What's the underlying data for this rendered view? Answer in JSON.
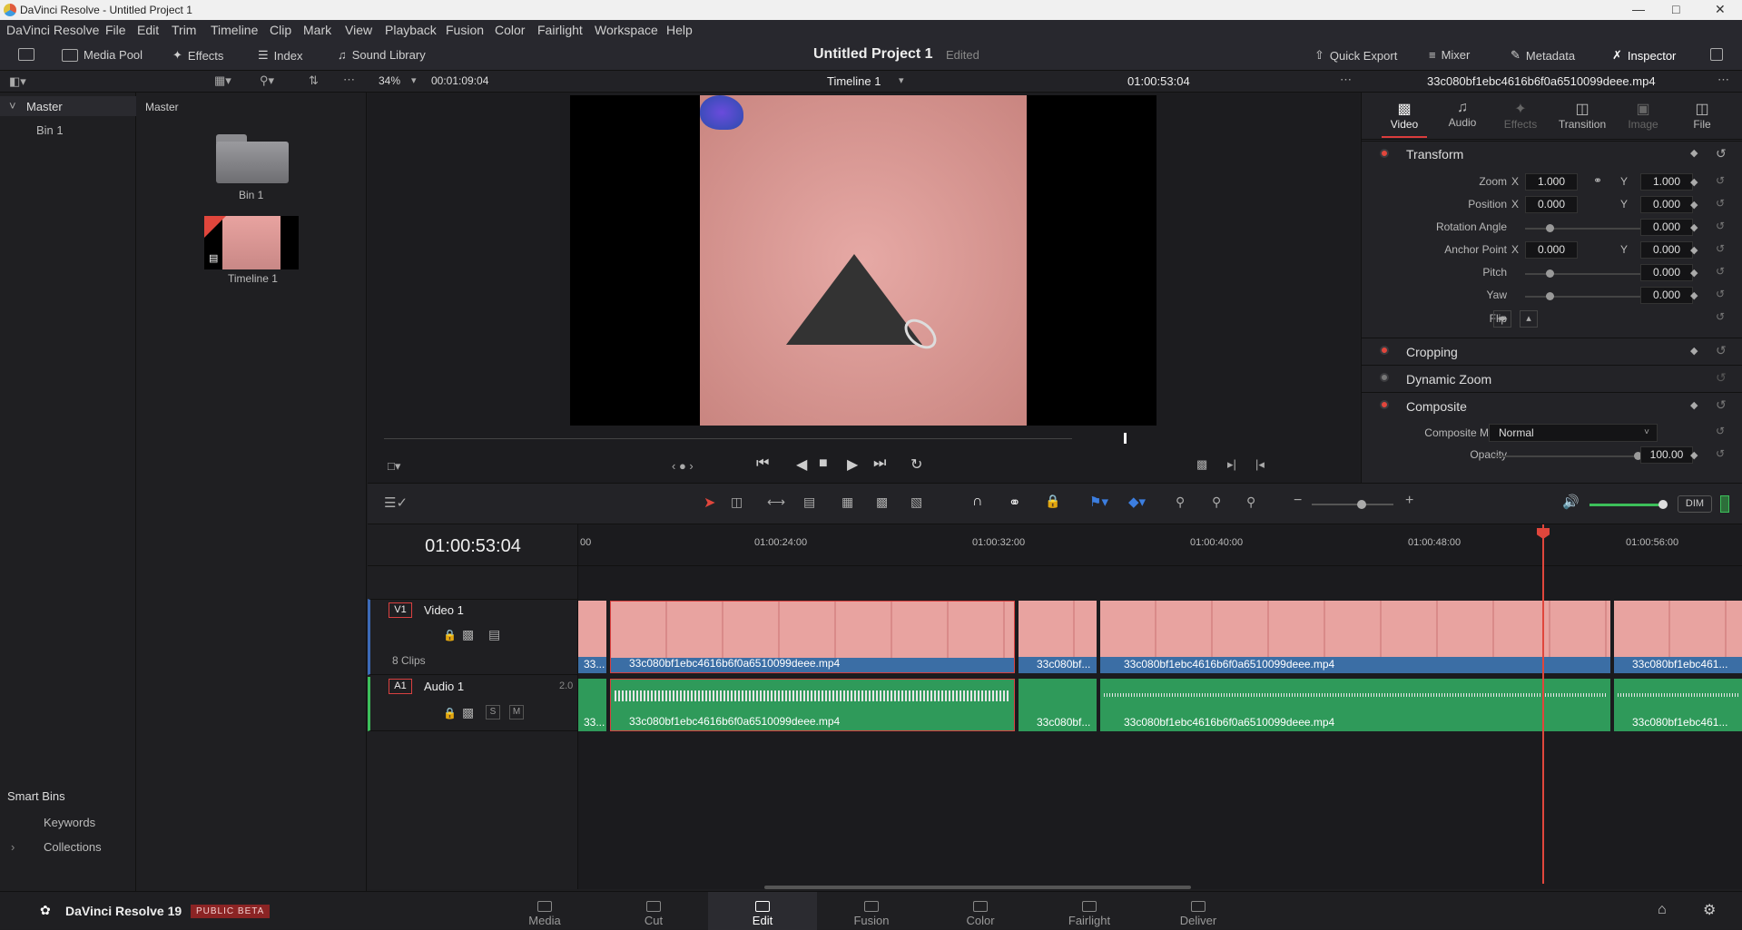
{
  "window": {
    "title": "DaVinci Resolve - Untitled Project 1"
  },
  "menu": [
    "DaVinci Resolve",
    "File",
    "Edit",
    "Trim",
    "Timeline",
    "Clip",
    "Mark",
    "View",
    "Playback",
    "Fusion",
    "Color",
    "Fairlight",
    "Workspace",
    "Help"
  ],
  "toolbar": {
    "media_pool": "Media Pool",
    "effects": "Effects",
    "index": "Index",
    "sound_library": "Sound Library",
    "project_title": "Untitled Project 1",
    "project_status": "Edited",
    "quick_export": "Quick Export",
    "mixer": "Mixer",
    "metadata": "Metadata",
    "inspector": "Inspector"
  },
  "viewer": {
    "zoom": "34%",
    "duration": "00:01:09:04",
    "timeline_name": "Timeline 1",
    "timecode": "01:00:53:04",
    "clip_name": "33c080bf1ebc4616b6f0a6510099deee.mp4"
  },
  "bins": {
    "master": "Master",
    "bin1": "Bin 1",
    "pool_header": "Master",
    "items": [
      {
        "label": "Bin 1"
      },
      {
        "label": "Timeline 1"
      }
    ]
  },
  "smart_bins": {
    "title": "Smart Bins",
    "keywords": "Keywords",
    "collections": "Collections"
  },
  "inspector": {
    "tabs": [
      "Video",
      "Audio",
      "Effects",
      "Transition",
      "Image",
      "File"
    ],
    "transform": "Transform",
    "zoom_label": "Zoom",
    "zoom_x": "1.000",
    "zoom_y": "1.000",
    "position_label": "Position",
    "pos_x": "0.000",
    "pos_y": "0.000",
    "rotation_label": "Rotation Angle",
    "rotation": "0.000",
    "anchor_label": "Anchor Point",
    "anchor_x": "0.000",
    "anchor_y": "0.000",
    "pitch_label": "Pitch",
    "pitch": "0.000",
    "yaw_label": "Yaw",
    "yaw": "0.000",
    "flip_label": "Flip",
    "x": "X",
    "y": "Y",
    "cropping": "Cropping",
    "dynamic_zoom": "Dynamic Zoom",
    "composite": "Composite",
    "composite_mode_label": "Composite Mode",
    "composite_mode": "Normal",
    "opacity_label": "Opacity",
    "opacity": "100.00"
  },
  "timeline": {
    "timecode": "01:00:53:04",
    "ruler": [
      "00",
      "01:00:24:00",
      "01:00:32:00",
      "01:00:40:00",
      "01:00:48:00",
      "01:00:56:00"
    ],
    "video_track": {
      "id": "V1",
      "name": "Video 1",
      "clips_count": "8 Clips"
    },
    "audio_track": {
      "id": "A1",
      "name": "Audio 1",
      "channels": "2.0",
      "solo": "S",
      "mute": "M"
    },
    "clips": [
      "33...",
      "33c080bf1ebc4616b6f0a6510099deee.mp4",
      "33c080bf...",
      "33c080bf1ebc4616b6f0a6510099deee.mp4",
      "33c080bf1ebc461..."
    ],
    "dim": "DIM"
  },
  "bottom": {
    "app_name": "DaVinci Resolve 19",
    "badge": "PUBLIC BETA",
    "pages": [
      "Media",
      "Cut",
      "Edit",
      "Fusion",
      "Color",
      "Fairlight",
      "Deliver"
    ]
  }
}
